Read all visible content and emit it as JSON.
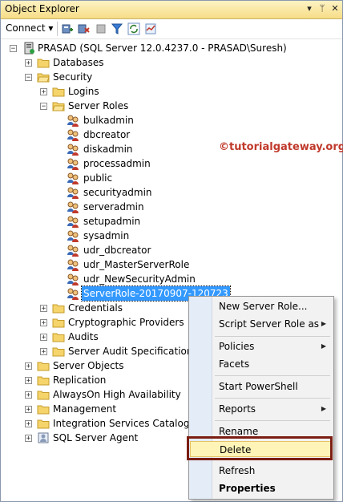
{
  "window": {
    "title": "Object Explorer",
    "controls": [
      "▾",
      "ᛘ",
      "✕"
    ]
  },
  "toolbar": {
    "connect_label": "Connect ▾"
  },
  "tree": {
    "server": "PRASAD (SQL Server 12.0.4237.0 - PRASAD\\Suresh)",
    "databases": "Databases",
    "security": "Security",
    "logins": "Logins",
    "server_roles": "Server Roles",
    "roles": [
      "bulkadmin",
      "dbcreator",
      "diskadmin",
      "processadmin",
      "public",
      "securityadmin",
      "serveradmin",
      "setupadmin",
      "sysadmin",
      "udr_dbcreator",
      "udr_MasterServerRole",
      "udr_NewSecurityAdmin",
      "ServerRole-20170907-120723"
    ],
    "security_children": [
      "Credentials",
      "Cryptographic Providers",
      "Audits",
      "Server Audit Specifications"
    ],
    "top_level": [
      "Server Objects",
      "Replication",
      "AlwaysOn High Availability",
      "Management",
      "Integration Services Catalogs"
    ],
    "agent": "SQL Server Agent"
  },
  "watermark": "©tutorialgateway.org",
  "context_menu": {
    "items": [
      {
        "label": "New Server Role...",
        "arrow": false
      },
      {
        "label": "Script Server Role as",
        "arrow": true
      },
      {
        "label": "Policies",
        "arrow": true
      },
      {
        "label": "Facets",
        "arrow": false
      },
      {
        "label": "Start PowerShell",
        "arrow": false
      },
      {
        "label": "Reports",
        "arrow": true
      },
      {
        "label": "Rename",
        "arrow": false
      },
      {
        "label": "Delete",
        "arrow": false
      },
      {
        "label": "Refresh",
        "arrow": false
      },
      {
        "label": "Properties",
        "arrow": false
      }
    ]
  },
  "colors": {
    "selection": "#3399ff",
    "highlight_border": "#7b1e12",
    "watermark": "#c0392b"
  }
}
